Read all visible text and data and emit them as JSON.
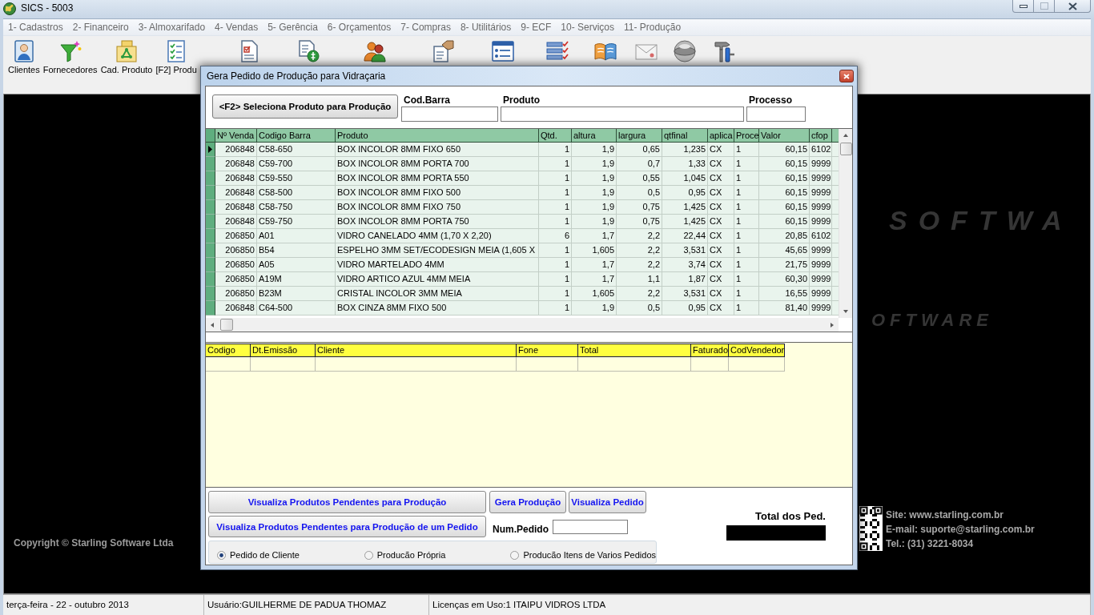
{
  "window": {
    "title": "SICS - 5003"
  },
  "menu": [
    "1- Cadastros",
    "2- Financeiro",
    "3- Almoxarifado",
    "4- Vendas",
    "5- Gerência",
    "6- Orçamentos",
    "7- Compras",
    "8- Utilitários",
    "9- ECF",
    "10- Serviços",
    "11- Produção"
  ],
  "toolbar": [
    {
      "label": "Clientes"
    },
    {
      "label": "Fornecedores"
    },
    {
      "label": "Cad. Produto"
    },
    {
      "label": "[F2] Produ"
    }
  ],
  "desktop": {
    "logo_text": [
      "SOFTWA",
      "OFTWARE"
    ],
    "copyright": "Copyright © Starling Software Ltda",
    "contact": [
      "Site: www.starling.com.br",
      "E-mail: suporte@starling.com.br",
      "Tel.: (31) 3221-8034"
    ]
  },
  "dialog": {
    "title": "Gera Pedido de Produção para Vidraçaria",
    "select_button": "<F2> Seleciona Produto para Produção",
    "filters": [
      {
        "label": "Cod.Barra"
      },
      {
        "label": "Produto"
      },
      {
        "label": "Processo"
      }
    ],
    "products_table": {
      "columns": [
        "Nº Venda",
        "Codigo Barra",
        "Produto",
        "Qtd.",
        "altura",
        "largura",
        "qtfinal",
        "aplica",
        "Proce",
        "Valor",
        "cfop"
      ],
      "rows": [
        {
          "selected": true,
          "cells": [
            "206848",
            "C58-650",
            "BOX INCOLOR 8MM FIXO 650",
            "1",
            "1,9",
            "0,65",
            "1,235",
            "CX",
            "1",
            "60,15",
            "6102"
          ]
        },
        {
          "selected": false,
          "cells": [
            "206848",
            "C59-700",
            "BOX INCOLOR 8MM PORTA 700",
            "1",
            "1,9",
            "0,7",
            "1,33",
            "CX",
            "1",
            "60,15",
            "9999"
          ]
        },
        {
          "selected": false,
          "cells": [
            "206848",
            "C59-550",
            "BOX INCOLOR 8MM PORTA 550",
            "1",
            "1,9",
            "0,55",
            "1,045",
            "CX",
            "1",
            "60,15",
            "9999"
          ]
        },
        {
          "selected": false,
          "cells": [
            "206848",
            "C58-500",
            "BOX INCOLOR 8MM FIXO 500",
            "1",
            "1,9",
            "0,5",
            "0,95",
            "CX",
            "1",
            "60,15",
            "9999"
          ]
        },
        {
          "selected": false,
          "cells": [
            "206848",
            "C58-750",
            "BOX INCOLOR 8MM FIXO 750",
            "1",
            "1,9",
            "0,75",
            "1,425",
            "CX",
            "1",
            "60,15",
            "9999"
          ]
        },
        {
          "selected": false,
          "cells": [
            "206848",
            "C59-750",
            "BOX INCOLOR 8MM PORTA 750",
            "1",
            "1,9",
            "0,75",
            "1,425",
            "CX",
            "1",
            "60,15",
            "9999"
          ]
        },
        {
          "selected": false,
          "cells": [
            "206850",
            "A01",
            "VIDRO CANELADO 4MM (1,70 X 2,20)",
            "6",
            "1,7",
            "2,2",
            "22,44",
            "CX",
            "1",
            "20,85",
            "6102"
          ]
        },
        {
          "selected": false,
          "cells": [
            "206850",
            "B54",
            "ESPELHO 3MM SET/ECODESIGN MEIA (1,605 X",
            "1",
            "1,605",
            "2,2",
            "3,531",
            "CX",
            "1",
            "45,65",
            "9999"
          ]
        },
        {
          "selected": false,
          "cells": [
            "206850",
            "A05",
            "VIDRO MARTELADO 4MM",
            "1",
            "1,7",
            "2,2",
            "3,74",
            "CX",
            "1",
            "21,75",
            "9999"
          ]
        },
        {
          "selected": false,
          "cells": [
            "206850",
            "A19M",
            "VIDRO ARTICO AZUL 4MM MEIA",
            "1",
            "1,7",
            "1,1",
            "1,87",
            "CX",
            "1",
            "60,30",
            "9999"
          ]
        },
        {
          "selected": false,
          "cells": [
            "206850",
            "B23M",
            "CRISTAL INCOLOR 3MM MEIA",
            "1",
            "1,605",
            "2,2",
            "3,531",
            "CX",
            "1",
            "16,55",
            "9999"
          ]
        },
        {
          "selected": false,
          "cells": [
            "206848",
            "C64-500",
            "BOX CINZA 8MM FIXO 500",
            "1",
            "1,9",
            "0,5",
            "0,95",
            "CX",
            "1",
            "81,40",
            "9999"
          ]
        }
      ]
    },
    "orders_table": {
      "columns": [
        "Codigo",
        "Dt.Emissão",
        "Cliente",
        "Fone",
        "Total",
        "Faturado",
        "CodVendedor"
      ]
    },
    "buttons": [
      "Visualiza Produtos Pendentes para Produção",
      "Gera Produção",
      "Visualiza Pedido",
      "Visualiza Produtos Pendentes para Produção de um Pedido"
    ],
    "order_number": {
      "label": "Num.Pedido"
    },
    "total": {
      "label": "Total dos Ped."
    },
    "modes": [
      {
        "label": "Pedido de Cliente",
        "selected": true
      },
      {
        "label": "Producão Própria",
        "selected": false
      },
      {
        "label": "Producão Itens de Varios Pedidos",
        "selected": false
      }
    ]
  },
  "status_bar": [
    "terça-feira - 22 - outubro 2013",
    "Usuário:GUILHERME DE PADUA THOMAZ",
    "Licenças em Uso:1 ITAIPU VIDROS LTDA"
  ]
}
